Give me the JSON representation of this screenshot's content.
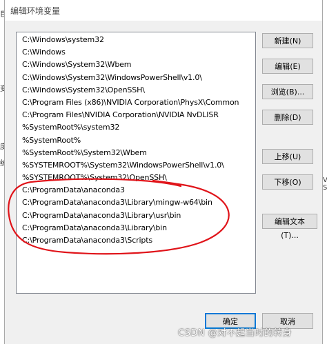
{
  "window": {
    "title": "编辑环境变量"
  },
  "background_fragments": [
    "巨",
    "变",
    "度",
    "统",
    "V S"
  ],
  "path_list": {
    "items": [
      "C:\\Windows\\system32",
      "C:\\Windows",
      "C:\\Windows\\System32\\Wbem",
      "C:\\Windows\\System32\\WindowsPowerShell\\v1.0\\",
      "C:\\Windows\\System32\\OpenSSH\\",
      "C:\\Program Files (x86)\\NVIDIA Corporation\\PhysX\\Common",
      "C:\\Program Files\\NVIDIA Corporation\\NVIDIA NvDLISR",
      "%SystemRoot%\\system32",
      "%SystemRoot%",
      "%SystemRoot%\\System32\\Wbem",
      "%SYSTEMROOT%\\System32\\WindowsPowerShell\\v1.0\\",
      "%SYSTEMROOT%\\System32\\OpenSSH\\",
      "C:\\ProgramData\\anaconda3",
      "C:\\ProgramData\\anaconda3\\Library\\mingw-w64\\bin",
      "C:\\ProgramData\\anaconda3\\Library\\usr\\bin",
      "C:\\ProgramData\\anaconda3\\Library\\bin",
      "C:\\ProgramData\\anaconda3\\Scripts"
    ]
  },
  "buttons": {
    "new": "新建(N)",
    "edit": "编辑(E)",
    "browse": "浏览(B)...",
    "delete": "删除(D)",
    "move_up": "上移(U)",
    "move_down": "下移(O)",
    "edit_text": "编辑文本(T)...",
    "ok": "确定",
    "cancel": "取消"
  },
  "annotation_color": "#e0141a",
  "watermark": "CSDN @对不起当时的转身"
}
